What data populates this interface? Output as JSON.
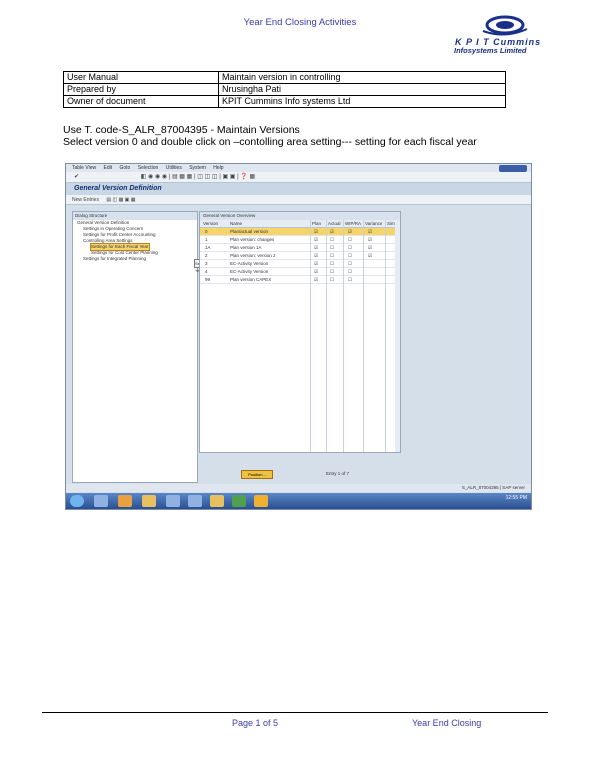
{
  "header": {
    "title": "Year End Closing Activities"
  },
  "logo": {
    "line1": "K P I T Cummins",
    "line2": "Infosystems Limited"
  },
  "meta_table": [
    [
      "User Manual",
      "Maintain version in controlling"
    ],
    [
      "Prepared by",
      "Nrusingha Pati"
    ],
    [
      "Owner of document",
      "KPIT Cummins Info systems Ltd"
    ]
  ],
  "instructions": {
    "line1": "Use T. code-S_ALR_87004395 - Maintain Versions",
    "line2": "Select version 0 and double click on –contolling area setting--- setting for each fiscal year"
  },
  "screenshot": {
    "menu": [
      "Table View",
      "Edit",
      "Goto",
      "Selection",
      "Utilities",
      "System",
      "Help"
    ],
    "title": "General Version Definition",
    "toolbar2": "New Entries",
    "tree_header": "Dialog Structure",
    "tree_items": [
      "General Version Definition",
      "Settings in Operating Concern",
      "Settings for Profit Center Accounting",
      "Controlling Area Settings",
      "Settings for Each Fiscal Year",
      "Settings for Cost Center Planning",
      "Settings for Integrated Planning"
    ],
    "popup": "Settings for Each Fiscal Year",
    "grid_header": "General Version Overview",
    "columns": [
      "Version",
      "Name",
      "Plan",
      "Actual",
      "WIP/RA",
      "Variance",
      "Sim"
    ],
    "rows": [
      [
        "0",
        "Plan/actual version"
      ],
      [
        "1",
        "Plan version: changes"
      ],
      [
        "1A",
        "Plan version 1A"
      ],
      [
        "2",
        "Plan version: version 2"
      ],
      [
        "3",
        "EC-Activity Version"
      ],
      [
        "4",
        "EC-Activity Version"
      ],
      [
        "99",
        "Plan version CAPEX"
      ]
    ],
    "ok_button": "Position...",
    "entry_text": "Entry 1 of 7",
    "status_text": "S_ALR_87004395 | SAP server",
    "tray_time": "12:55 PM"
  },
  "footer": {
    "page": "Page 1 of 5",
    "title": "Year End Closing"
  },
  "colors": {
    "accent_text": "#3a3aa8",
    "selection": "#f5d46a",
    "sap_bg": "#d5dfe9"
  }
}
